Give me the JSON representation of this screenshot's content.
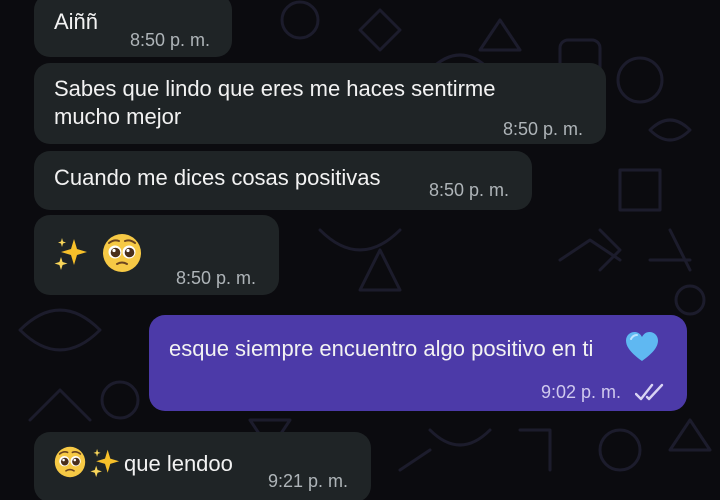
{
  "messages": [
    {
      "direction": "in",
      "text": "Aiññ",
      "time": "8:50 p. m."
    },
    {
      "direction": "in",
      "text_line1": "Sabes que lindo que eres me haces sentirme",
      "text_line2": "mucho mejor",
      "time": "8:50 p. m."
    },
    {
      "direction": "in",
      "text": "Cuando me dices cosas positivas",
      "time": "8:50 p. m."
    },
    {
      "direction": "in",
      "emojis": [
        "sparkles",
        "pleading-face"
      ],
      "time": "8:50 p. m."
    },
    {
      "direction": "out",
      "text": "esque siempre encuentro algo positivo en ti",
      "emoji": "blue-heart",
      "time": "9:02 p. m.",
      "status_icon": "double-check-read"
    },
    {
      "direction": "in",
      "emojis": [
        "pleading-face",
        "sparkles"
      ],
      "text": "que lendoo",
      "time": "9:21 p. m."
    }
  ],
  "colors": {
    "background": "#0b0b0f",
    "incoming_bubble": "#1f2426",
    "outgoing_bubble": "#4c3aa8",
    "timestamp": "#aeb4b8"
  }
}
